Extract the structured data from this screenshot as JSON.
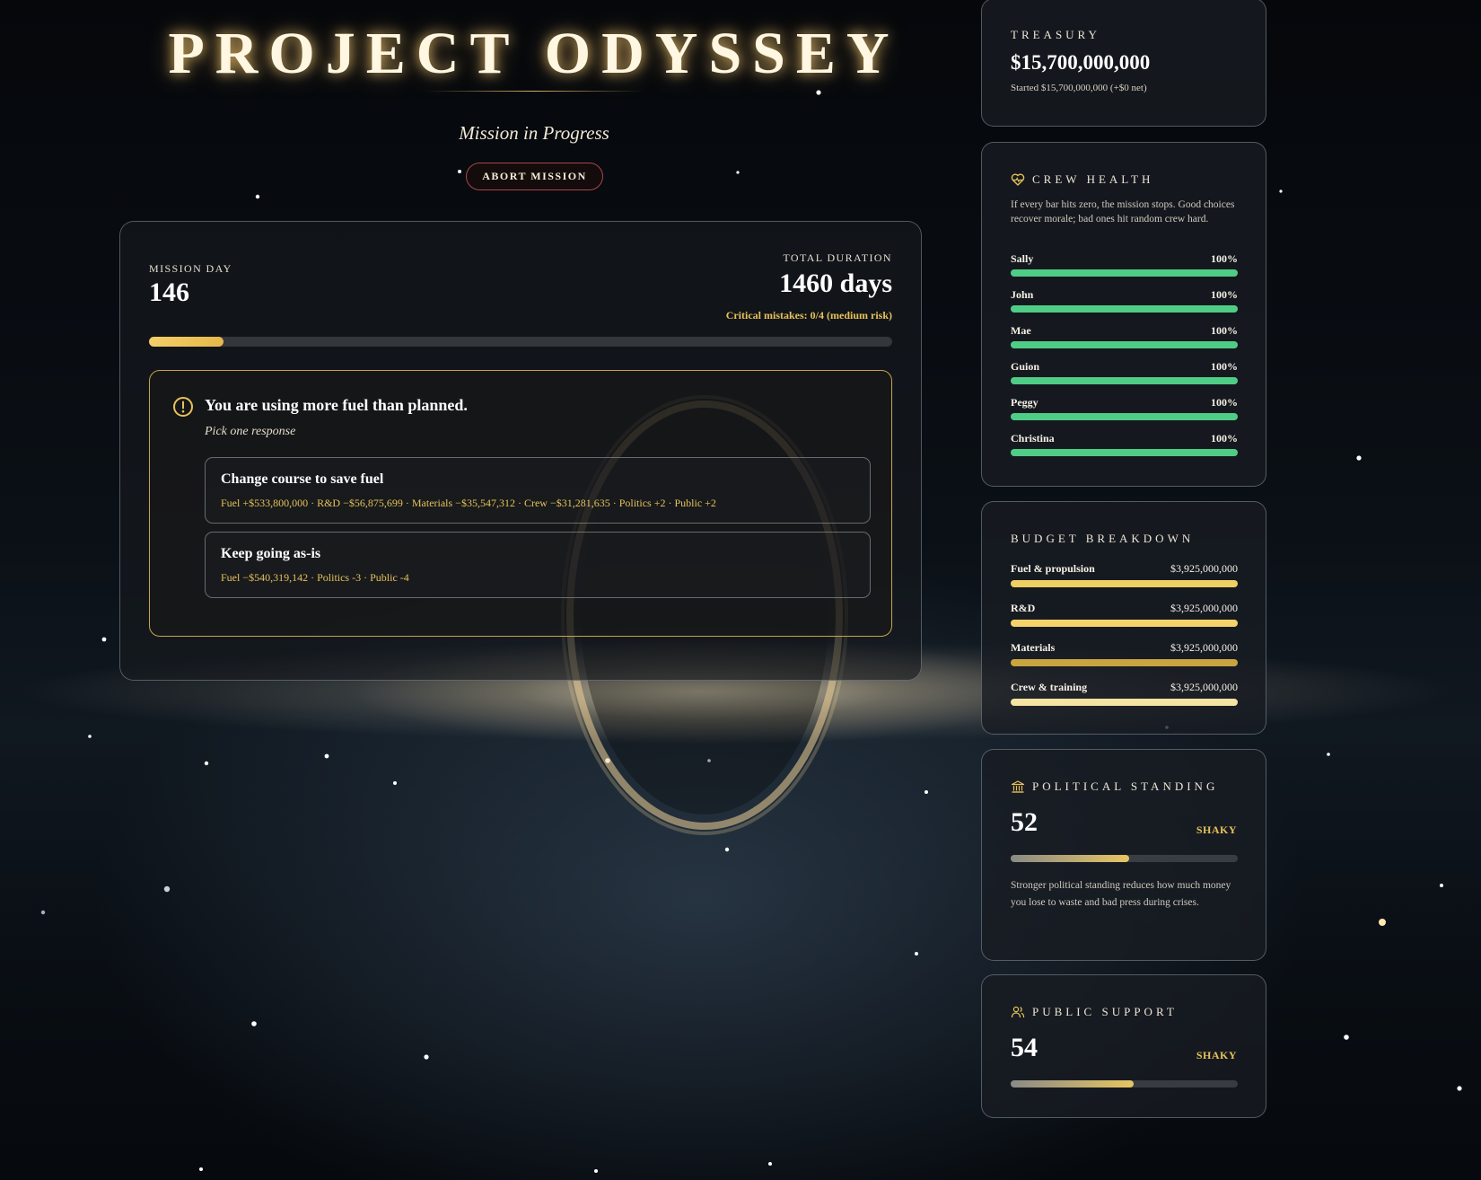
{
  "header": {
    "title": "PROJECT ODYSSEY",
    "subtitle": "Mission in Progress",
    "abort_label": "ABORT MISSION"
  },
  "mission": {
    "day_label": "MISSION DAY",
    "day_value": "146",
    "duration_label": "TOTAL DURATION",
    "duration_value": "1460 days",
    "mistakes": "Critical mistakes: 0/4 (medium risk)",
    "progress_fraction": 0.1
  },
  "event": {
    "icon": "alert-circle-icon",
    "title": "You are using more fuel than planned.",
    "prompt": "Pick one response",
    "choices": [
      {
        "title": "Change course to save fuel",
        "effects": "Fuel +$533,800,000 · R&D −$56,875,699 · Materials −$35,547,312 · Crew −$31,281,635 · Politics +2 · Public +2"
      },
      {
        "title": "Keep going as-is",
        "effects": "Fuel −$540,319,142 · Politics -3 · Public -4"
      }
    ]
  },
  "treasury": {
    "title": "TREASURY",
    "value": "$15,700,000,000",
    "sub": "Started $15,700,000,000 (+$0 net)"
  },
  "crew": {
    "icon": "heart-pulse-icon",
    "title": "CREW HEALTH",
    "description": "If every bar hits zero, the mission stops. Good choices recover morale; bad ones hit random crew hard.",
    "members": [
      {
        "name": "Sally",
        "pct_label": "100%",
        "health": 1.0
      },
      {
        "name": "John",
        "pct_label": "100%",
        "health": 1.0
      },
      {
        "name": "Mae",
        "pct_label": "100%",
        "health": 1.0
      },
      {
        "name": "Guion",
        "pct_label": "100%",
        "health": 1.0
      },
      {
        "name": "Peggy",
        "pct_label": "100%",
        "health": 1.0
      },
      {
        "name": "Christina",
        "pct_label": "100%",
        "health": 1.0
      }
    ]
  },
  "budget": {
    "title": "BUDGET BREAKDOWN",
    "items": [
      {
        "name": "Fuel & propulsion",
        "value": "$3,925,000,000",
        "share": 1.0,
        "color": "#f0cf63"
      },
      {
        "name": "R&D",
        "value": "$3,925,000,000",
        "share": 1.0,
        "color": "#f4d36a"
      },
      {
        "name": "Materials",
        "value": "$3,925,000,000",
        "share": 1.0,
        "color": "#c9a53f"
      },
      {
        "name": "Crew & training",
        "value": "$3,925,000,000",
        "share": 1.0,
        "color": "#f4e3a2"
      }
    ]
  },
  "political": {
    "icon": "bank-icon",
    "title": "POLITICAL STANDING",
    "value": "52",
    "status": "SHAKY",
    "level": 0.52,
    "description": "Stronger political standing reduces how much money you lose to waste and bad press during crises."
  },
  "public": {
    "icon": "users-icon",
    "title": "PUBLIC SUPPORT",
    "value": "54",
    "status": "SHAKY",
    "level": 0.54
  }
}
